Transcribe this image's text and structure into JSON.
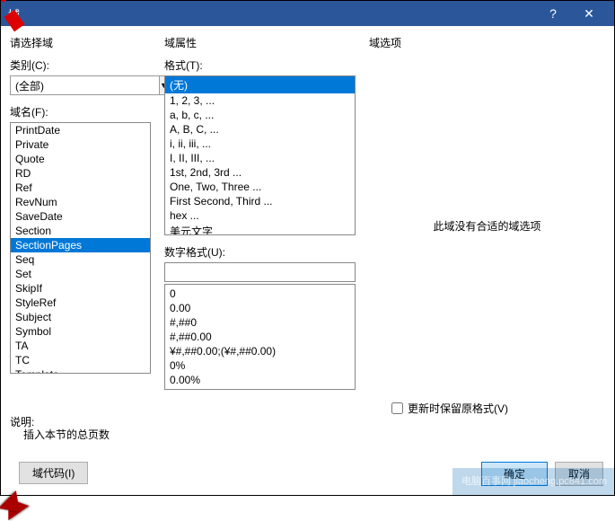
{
  "title": "域",
  "help_icon": "?",
  "close_icon": "✕",
  "left": {
    "section_label": "请选择域",
    "category_label": "类别(C):",
    "category_value": "(全部)",
    "fieldname_label": "域名(F):",
    "fields": [
      "PrintDate",
      "Private",
      "Quote",
      "RD",
      "Ref",
      "RevNum",
      "SaveDate",
      "Section",
      "SectionPages",
      "Seq",
      "Set",
      "SkipIf",
      "StyleRef",
      "Subject",
      "Symbol",
      "TA",
      "TC",
      "Template"
    ],
    "selected_field": "SectionPages",
    "desc_label": "说明:",
    "desc_text": "插入本节的总页数",
    "code_button": "域代码(I)"
  },
  "mid": {
    "section_label": "域属性",
    "format_label": "格式(T):",
    "formats": [
      "(无)",
      "1, 2, 3, ...",
      "a, b, c, ...",
      "A, B, C, ...",
      "i, ii, iii, ...",
      "I, II, III, ...",
      "1st, 2nd, 3rd ...",
      "One, Two, Three ...",
      "First Second, Third ...",
      "hex ...",
      "美元文字"
    ],
    "selected_format": "(无)",
    "numeric_label": "数字格式(U):",
    "numeric_formats": [
      "",
      "0",
      "0.00",
      "#,##0",
      "#,##0.00",
      "¥#,##0.00;(¥#,##0.00)",
      "0%",
      "0.00%"
    ]
  },
  "right": {
    "section_label": "域选项",
    "no_options_msg": "此域没有合适的域选项",
    "preserve_label": "更新时保留原格式(V)",
    "ok": "确定",
    "cancel": "取消"
  },
  "watermark": "电脑百事网 jiaocheng.pc841.com"
}
